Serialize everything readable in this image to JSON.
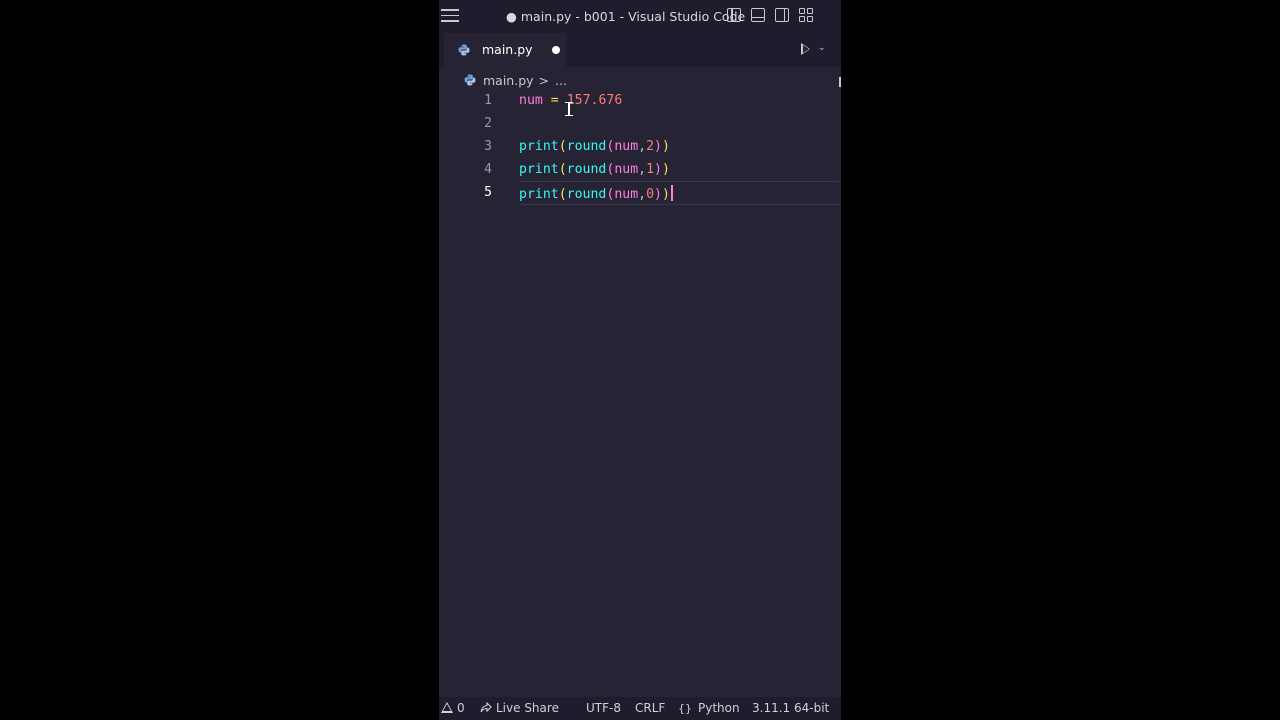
{
  "window": {
    "title": "● main.py - b001 - Visual Studio Code"
  },
  "icons": {
    "menu": "hamburger-menu-icon",
    "python": "python-file-icon",
    "run": "play-icon",
    "warning": "warning-icon",
    "live_share": "live-share-icon"
  },
  "tabs": [
    {
      "label": "main.py",
      "dirty": true
    }
  ],
  "breadcrumb": {
    "file": "main.py",
    "separator": ">",
    "more": "..."
  },
  "editor": {
    "active_line": 5,
    "lines": [
      {
        "number": "1",
        "text": "num = 157.676"
      },
      {
        "number": "2",
        "text": ""
      },
      {
        "number": "3",
        "text": "print(round(num,2))"
      },
      {
        "number": "4",
        "text": "print(round(num,1))"
      },
      {
        "number": "5",
        "text": "print(round(num,0))"
      }
    ]
  },
  "statusbar": {
    "problems": "0",
    "live_share": "Live Share",
    "encoding": "UTF-8",
    "eol": "CRLF",
    "language": "Python",
    "interpreter": "3.11.1 64-bit"
  },
  "colors": {
    "editor_bg": "#262335",
    "chrome_bg": "#1f1c2e",
    "variable": "#ff7edb",
    "number": "#f97e72",
    "function": "#36f9f6",
    "operator": "#fede5d"
  }
}
